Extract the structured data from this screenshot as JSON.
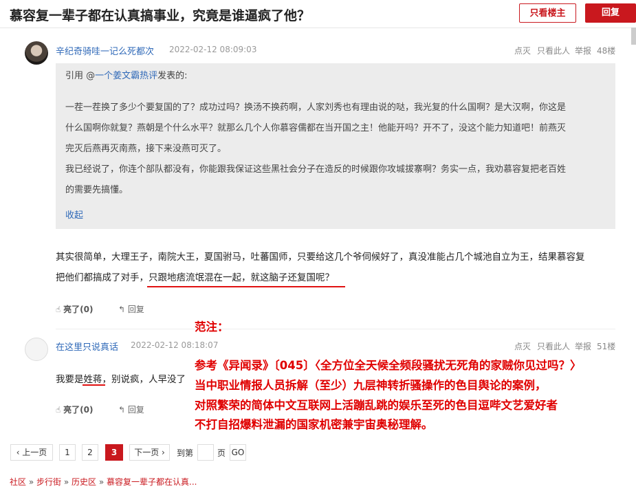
{
  "header": {
    "title": "慕容复一辈子都在认真搞事业，究竟是谁逼疯了他？",
    "only_owner": "只看楼主",
    "reply": "回复"
  },
  "posts": [
    {
      "username": "辛纪奇骑哇一记么死都次",
      "time": "2022-02-12 08:09:03",
      "ops": [
        "点灭",
        "只看此人",
        "举报"
      ],
      "floor": "48楼",
      "quote": {
        "prefix": "引用 @",
        "author": "一个姜文霸热评",
        "suffix": "发表的:",
        "lines": [
          "一茬一茬换了多少个要复国的了？成功过吗？换汤不换药啊，人家刘秀也有理由说的哒，我光复的什么国啊？是大汉啊，你这是",
          "什么国啊你就复？燕朝是个什么水平？就那么几个人你慕容儒都在当开国之主！他能开吗？开不了，没这个能力知道吧！前燕灭",
          "完灭后燕再灭南燕，接下来没燕可灭了。",
          "我已经说了，你连个部队都没有，你能跟我保证这些黑社会分子在造反的时候跟你攻城拔寨啊？务实一点，我劝慕容复把老百姓",
          "的需要先搞懂。"
        ],
        "collapse": "收起"
      },
      "body_line1": "其实很简单，大理王子，南院大王，夏国驸马，吐蕃国师，只要给这几个爷伺候好了，真没准能占几个城池自立为王，结果慕容复",
      "body_line2_a": "把他们都搞成了对手，",
      "body_line2_b": "只跟地痞流氓混在一起，就这脑子还复国呢？",
      "like": "亮了(0)",
      "reply": "回复"
    },
    {
      "username": "在这里只说真话",
      "time": "2022-02-12 08:18:07",
      "ops": [
        "点灭",
        "只看此人",
        "举报"
      ],
      "floor": "51楼",
      "body_a": "我要是",
      "body_b": "姓蒋",
      "body_c": "，别说疯，人早没了",
      "like": "亮了(0)",
      "reply": "回复"
    }
  ],
  "annotation": {
    "label": "范注：",
    "lines": [
      "参考《异闻录》〔045〕〈全方位全天候全频段骚扰无死角的家贼你见过吗？〉",
      "当中职业情报人员拆解（至少）九层神转折骚操作的色目舆论的案例，",
      "对照繁荣的简体中文互联网上活蹦乱跳的娱乐至死的色目逗哔文艺爱好者",
      "不打自招爆料泄漏的国家机密兼宇宙奥秘理解。"
    ]
  },
  "pagination": {
    "prev": "‹ 上一页",
    "pages": [
      "1",
      "2",
      "3"
    ],
    "current": "3",
    "next": "下一页 ›",
    "goto_prefix": "到第",
    "goto_suffix": "页",
    "go": "GO"
  },
  "breadcrumb": [
    "社区",
    "步行街",
    "历史区",
    "慕容复一辈子都在认真..."
  ],
  "colors": {
    "accent": "#c9181e",
    "link": "#2f69b8",
    "annotation": "#e00000"
  }
}
